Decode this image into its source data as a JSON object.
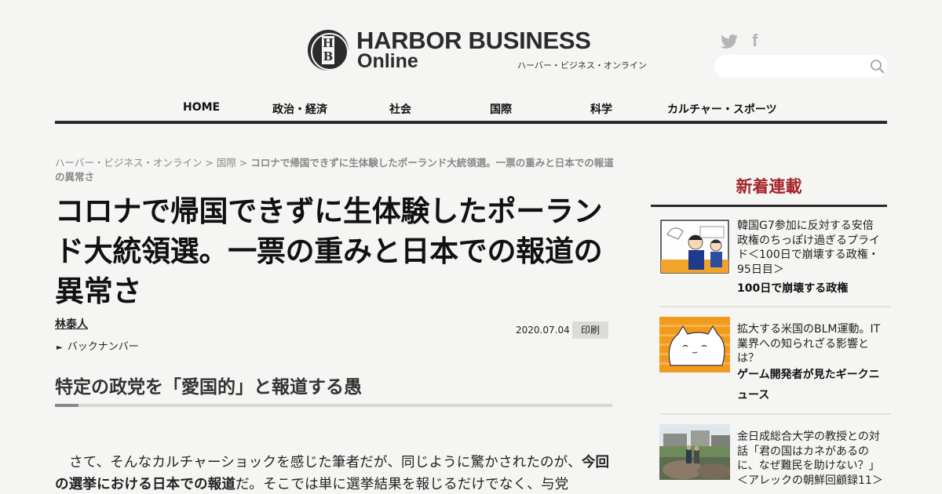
{
  "header": {
    "logo_letters": "H\nB",
    "logo_title": "HARBOR BUSINESS",
    "logo_online": "Online",
    "logo_kana": "ハーバー・ビジネス・オンライン",
    "sns_icons": [
      "twitter-icon",
      "facebook-icon"
    ],
    "search_placeholder": ""
  },
  "nav": {
    "items": [
      {
        "label": "HOME"
      },
      {
        "label": "政治・経済"
      },
      {
        "label": "社会"
      },
      {
        "label": "国際"
      },
      {
        "label": "科学"
      },
      {
        "label": "カルチャー・スポーツ"
      }
    ]
  },
  "article": {
    "breadcrumb": {
      "home": "ハーバー・ビジネス・オンライン",
      "separator": " > ",
      "category": "国際",
      "current": "コロナで帰国できずに生体験したポーランド大統領選。一票の重みと日本での報道の異常さ"
    },
    "title": "コロナで帰国できずに生体験したポーランド大統領選。一票の重みと日本での報道の異常さ",
    "author": "林泰人",
    "backnumber": "バックナンバー",
    "date": "2020.07.04",
    "print_label": "印刷",
    "subheading": "特定の政党を「愛国的」と報道する愚",
    "body": {
      "part1": "さて、そんなカルチャーショックを感じた筆者だが、同じように驚かされたのが、",
      "bold": "今回の選挙における日本での報道",
      "part2": "だ。そこでは単に選挙結果を報じるだけでなく、与党"
    }
  },
  "sidebar": {
    "title": "新着連載",
    "items": [
      {
        "headline": "韓国G7参加に反対する安倍政権のちっぽけ過ぎるプライド＜100日で崩壊する政権・95日目＞",
        "series": "100日で崩壊する政権"
      },
      {
        "headline": "拡大する米国のBLM運動。IT業界への知られざる影響とは？",
        "series": "ゲーム開発者が見たギークニュース"
      },
      {
        "headline": "金日成総合大学の教授との対話「君の国はカネがあるのに、なぜ難民を助けない？」＜アレックの朝鮮回顧録11＞",
        "series": ""
      }
    ]
  },
  "colors": {
    "accent_red": "#a3262b",
    "dark": "#2b2b2b",
    "background": "#f5f5f3"
  }
}
